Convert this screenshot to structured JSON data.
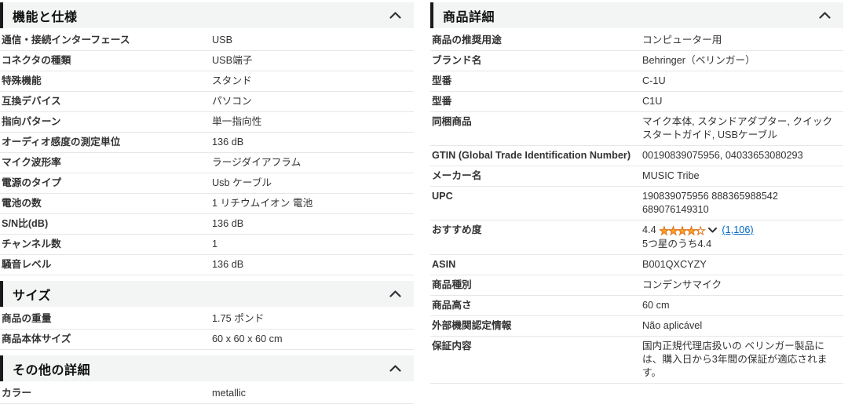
{
  "colors": {
    "header_bg": "#f3f4f4",
    "header_left_border": "#17191c",
    "row_divider": "#e7e7e7",
    "text": "#333333",
    "link": "#0066c0",
    "star_fill": "#ffa41c",
    "star_outline": "#de7921"
  },
  "icons": {
    "section_header": "chevron-up-icon",
    "rating_dropdown": "chevron-down-icon",
    "star_rating": "star-rating-icon"
  },
  "rating": {
    "value": "4.4",
    "stars_out_of": 5,
    "stars_percent": 88,
    "stars_glyphs": "★★★★★",
    "reviews_count_link": "(1,106)",
    "subtitle": "5つ星のうち4.4"
  },
  "columns": {
    "left": [
      {
        "title": "機能と仕様",
        "rows": [
          {
            "label": "通信・接続インターフェース",
            "value": "USB"
          },
          {
            "label": "コネクタの種類",
            "value": "USB端子"
          },
          {
            "label": "特殊機能",
            "value": "スタンド"
          },
          {
            "label": "互換デバイス",
            "value": "パソコン"
          },
          {
            "label": "指向パターン",
            "value": "単一指向性"
          },
          {
            "label": "オーディオ感度の測定単位",
            "value": "136 dB"
          },
          {
            "label": "マイク波形率",
            "value": "ラージダイアフラム"
          },
          {
            "label": "電源のタイプ",
            "value": "Usb ケーブル"
          },
          {
            "label": "電池の数",
            "value": "1 リチウムイオン 電池"
          },
          {
            "label": "S/N比(dB)",
            "value": "136 dB"
          },
          {
            "label": "チャンネル数",
            "value": "1"
          },
          {
            "label": "騒音レベル",
            "value": "136 dB"
          }
        ]
      },
      {
        "title": "サイズ",
        "rows": [
          {
            "label": "商品の重量",
            "value": "1.75 ポンド"
          },
          {
            "label": "商品本体サイズ",
            "value": "60 x 60 x 60 cm"
          }
        ]
      },
      {
        "title": "その他の詳細",
        "rows": [
          {
            "label": "カラー",
            "value": "metallic"
          }
        ]
      }
    ],
    "right": [
      {
        "title": "商品詳細",
        "rows": [
          {
            "label": "商品の推奨用途",
            "value": "コンピューター用"
          },
          {
            "label": "ブランド名",
            "value": "Behringer（ベリンガー）"
          },
          {
            "label": "型番",
            "value": "C-1U"
          },
          {
            "label": "型番",
            "value": "C1U"
          },
          {
            "label": "同梱商品",
            "value": "マイク本体, スタンドアダプター, クイックスタートガイド, USBケーブル"
          },
          {
            "label": "GTIN (Global Trade Identification Number)",
            "value": "00190839075956, 04033653080293"
          },
          {
            "label": "メーカー名",
            "value": "MUSIC Tribe"
          },
          {
            "label": "UPC",
            "value": "190839075956 888365988542 689076149310"
          },
          {
            "label": "おすすめ度",
            "type": "rating"
          },
          {
            "label": "ASIN",
            "value": "B001QXCYZY"
          },
          {
            "label": "商品種別",
            "value": "コンデンサマイク"
          },
          {
            "label": "商品高さ",
            "value": "60 cm"
          },
          {
            "label": "外部機関認定情報",
            "value": "Não aplicável"
          },
          {
            "label": "保証内容",
            "value": "国内正規代理店扱いの ベリンガー製品には、購入日から3年間の保証が適応されます。"
          }
        ]
      }
    ]
  }
}
